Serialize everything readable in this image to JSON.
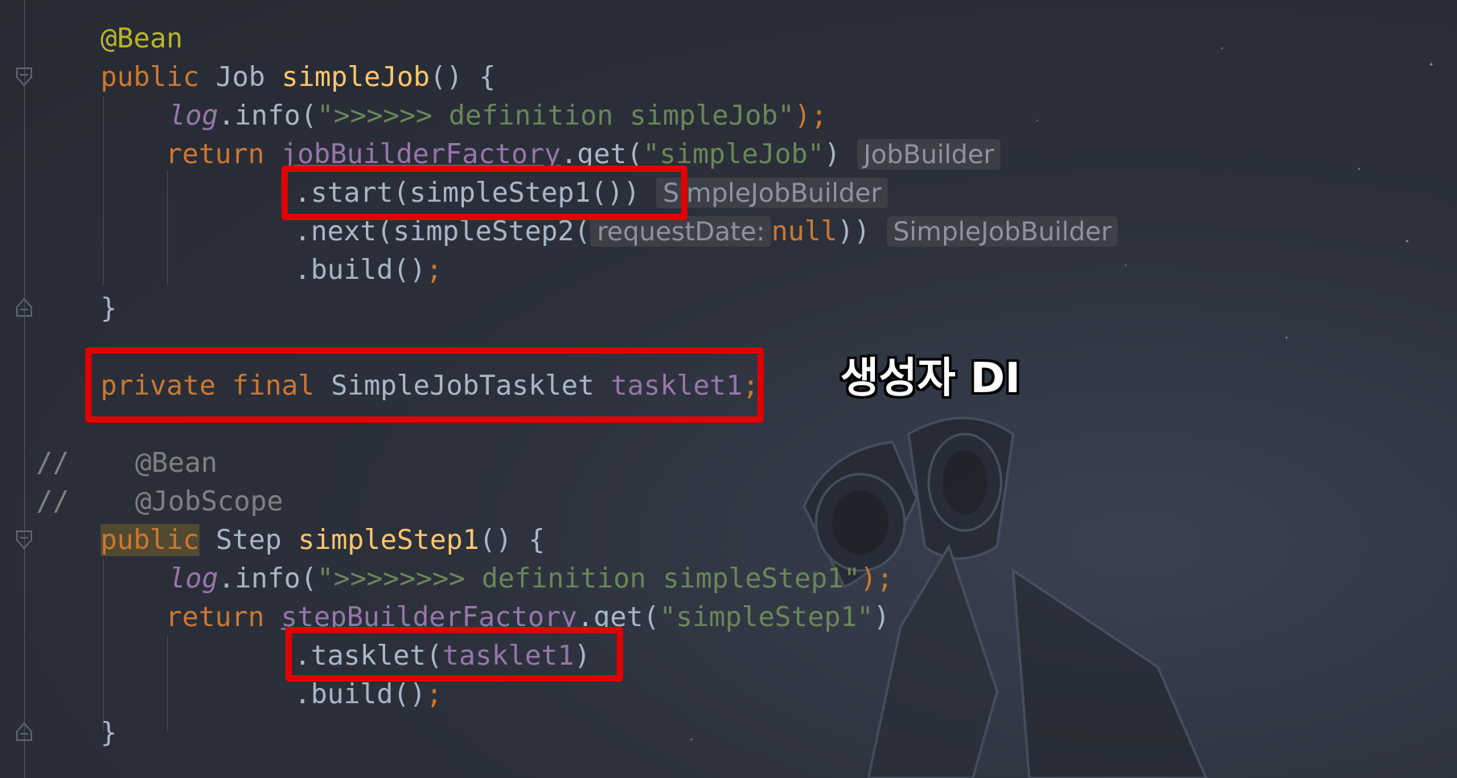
{
  "code": {
    "l1": {
      "a": "@Bean"
    },
    "l2": {
      "kw": "public",
      "type": "Job",
      "fn": "simpleJob",
      "rest": "() {"
    },
    "l3": {
      "log": "log",
      "dot": ".info(",
      "str": "\">>>>>> definition simpleJob\"",
      "end": ");"
    },
    "l4": {
      "kw": "return",
      "field": "jobBuilderFactory",
      "mid": ".get(",
      "str": "\"simpleJob\"",
      "close": ")",
      "hint": "JobBuilder"
    },
    "l5": {
      "text": ".start(simpleStep1())",
      "hint": "SimpleJobBuilder"
    },
    "l6": {
      "text": ".next(simpleStep2(",
      "param": "requestDate:",
      "nul": "null",
      "close": "))",
      "hint": "SimpleJobBuilder"
    },
    "l7": {
      "text": ".build()",
      "semi": ";"
    },
    "l8": {
      "text": "}"
    },
    "l9": {
      "kw": "private final",
      "type": "SimpleJobTasklet",
      "field": "tasklet1",
      "semi": ";"
    },
    "l10": {
      "slash": "//",
      "text": "@Bean"
    },
    "l11": {
      "slash": "//",
      "text": "@JobScope"
    },
    "l12": {
      "kw": "public",
      "type": "Step",
      "fn": "simpleStep1",
      "rest": "() {"
    },
    "l13": {
      "log": "log",
      "dot": ".info(",
      "str": "\">>>>>>>> definition simpleStep1\"",
      "end": ");"
    },
    "l14": {
      "kw": "return",
      "field": "stepBuilderFactory",
      "mid": ".get(",
      "str": "\"simpleStep1\"",
      "close": ")"
    },
    "l15": {
      "text": ".tasklet(",
      "field": "tasklet1",
      "close": ")"
    },
    "l16": {
      "text": ".build()",
      "semi": ";"
    },
    "l17": {
      "text": "}"
    }
  },
  "caption": "생성자 DI",
  "colors": {
    "highlight_box": "#e00000",
    "keyword": "#cc7832",
    "string": "#6a8759",
    "function": "#ffc66d",
    "field": "#9876aa",
    "annotation": "#bbb529"
  }
}
